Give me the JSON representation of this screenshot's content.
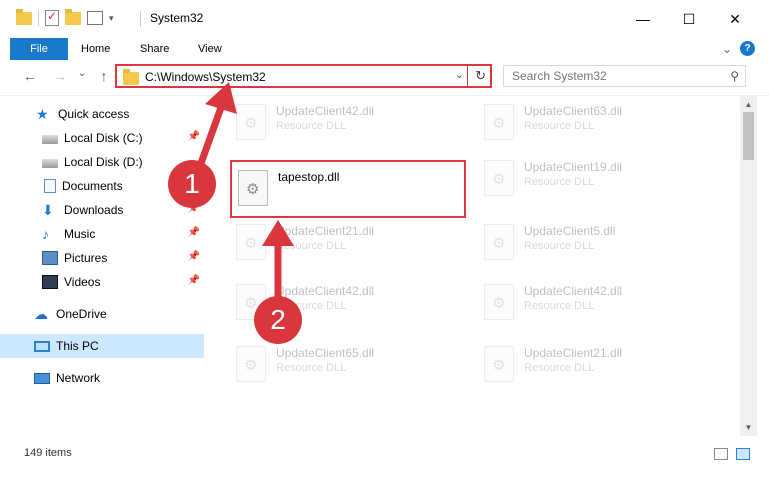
{
  "window": {
    "title": "System32",
    "minimize": "—",
    "maximize": "☐",
    "close": "✕"
  },
  "ribbon": {
    "file": "File",
    "tabs": [
      "Home",
      "Share",
      "View"
    ],
    "expand_glyph": "⌄",
    "help_glyph": "?"
  },
  "nav": {
    "back": "←",
    "forward": "→",
    "recent": "⌄",
    "up": "↑"
  },
  "address": {
    "path": "C:\\Windows\\System32",
    "dropdown": "⌄",
    "refresh": "↻"
  },
  "search": {
    "placeholder": "Search System32",
    "icon_glyph": "⚲"
  },
  "sidebar": {
    "items": [
      {
        "label": "Quick access",
        "icon": "star-icon"
      },
      {
        "label": "Local Disk (C:)",
        "icon": "drive-icon",
        "pinned": true
      },
      {
        "label": "Local Disk (D:)",
        "icon": "drive-icon"
      },
      {
        "label": "Documents",
        "icon": "documents-icon"
      },
      {
        "label": "Downloads",
        "icon": "downloads-icon",
        "pinned": true
      },
      {
        "label": "Music",
        "icon": "music-icon",
        "pinned": true
      },
      {
        "label": "Pictures",
        "icon": "pictures-icon",
        "pinned": true
      },
      {
        "label": "Videos",
        "icon": "videos-icon",
        "pinned": true
      },
      {
        "label": "OneDrive",
        "icon": "onedrive-icon"
      },
      {
        "label": "This PC",
        "icon": "this-pc-icon",
        "selected": true
      },
      {
        "label": "Network",
        "icon": "network-icon"
      }
    ],
    "pin_glyph": "📌"
  },
  "files": [
    {
      "name": "UpdateClient42.dll",
      "type": "Resource DLL",
      "faded": true
    },
    {
      "name": "UpdateClient63.dll",
      "type": "Resource DLL",
      "faded": true
    },
    {
      "name": "tapestop.dll",
      "type": "",
      "faded": false,
      "highlighted": true
    },
    {
      "name": "UpdateClient19.dll",
      "type": "Resource DLL",
      "faded": true
    },
    {
      "name": "UpdateClient21.dll",
      "type": "Resource DLL",
      "faded": true
    },
    {
      "name": "UpdateClient5.dll",
      "type": "Resource DLL",
      "faded": true
    },
    {
      "name": "UpdateClient42.dll",
      "type": "Resource DLL",
      "faded": true
    },
    {
      "name": "UpdateClient42.dll",
      "type": "Resource DLL",
      "faded": true
    },
    {
      "name": "UpdateClient65.dll",
      "type": "Resource DLL",
      "faded": true
    },
    {
      "name": "UpdateClient21.dll",
      "type": "Resource DLL",
      "faded": true
    }
  ],
  "status": {
    "item_count": "149 items"
  },
  "annotations": {
    "step1": "1",
    "step2": "2",
    "color": "#d9363e"
  },
  "colors": {
    "accent": "#1979ca",
    "highlight": "#d9363e",
    "selection": "#cce8ff"
  }
}
